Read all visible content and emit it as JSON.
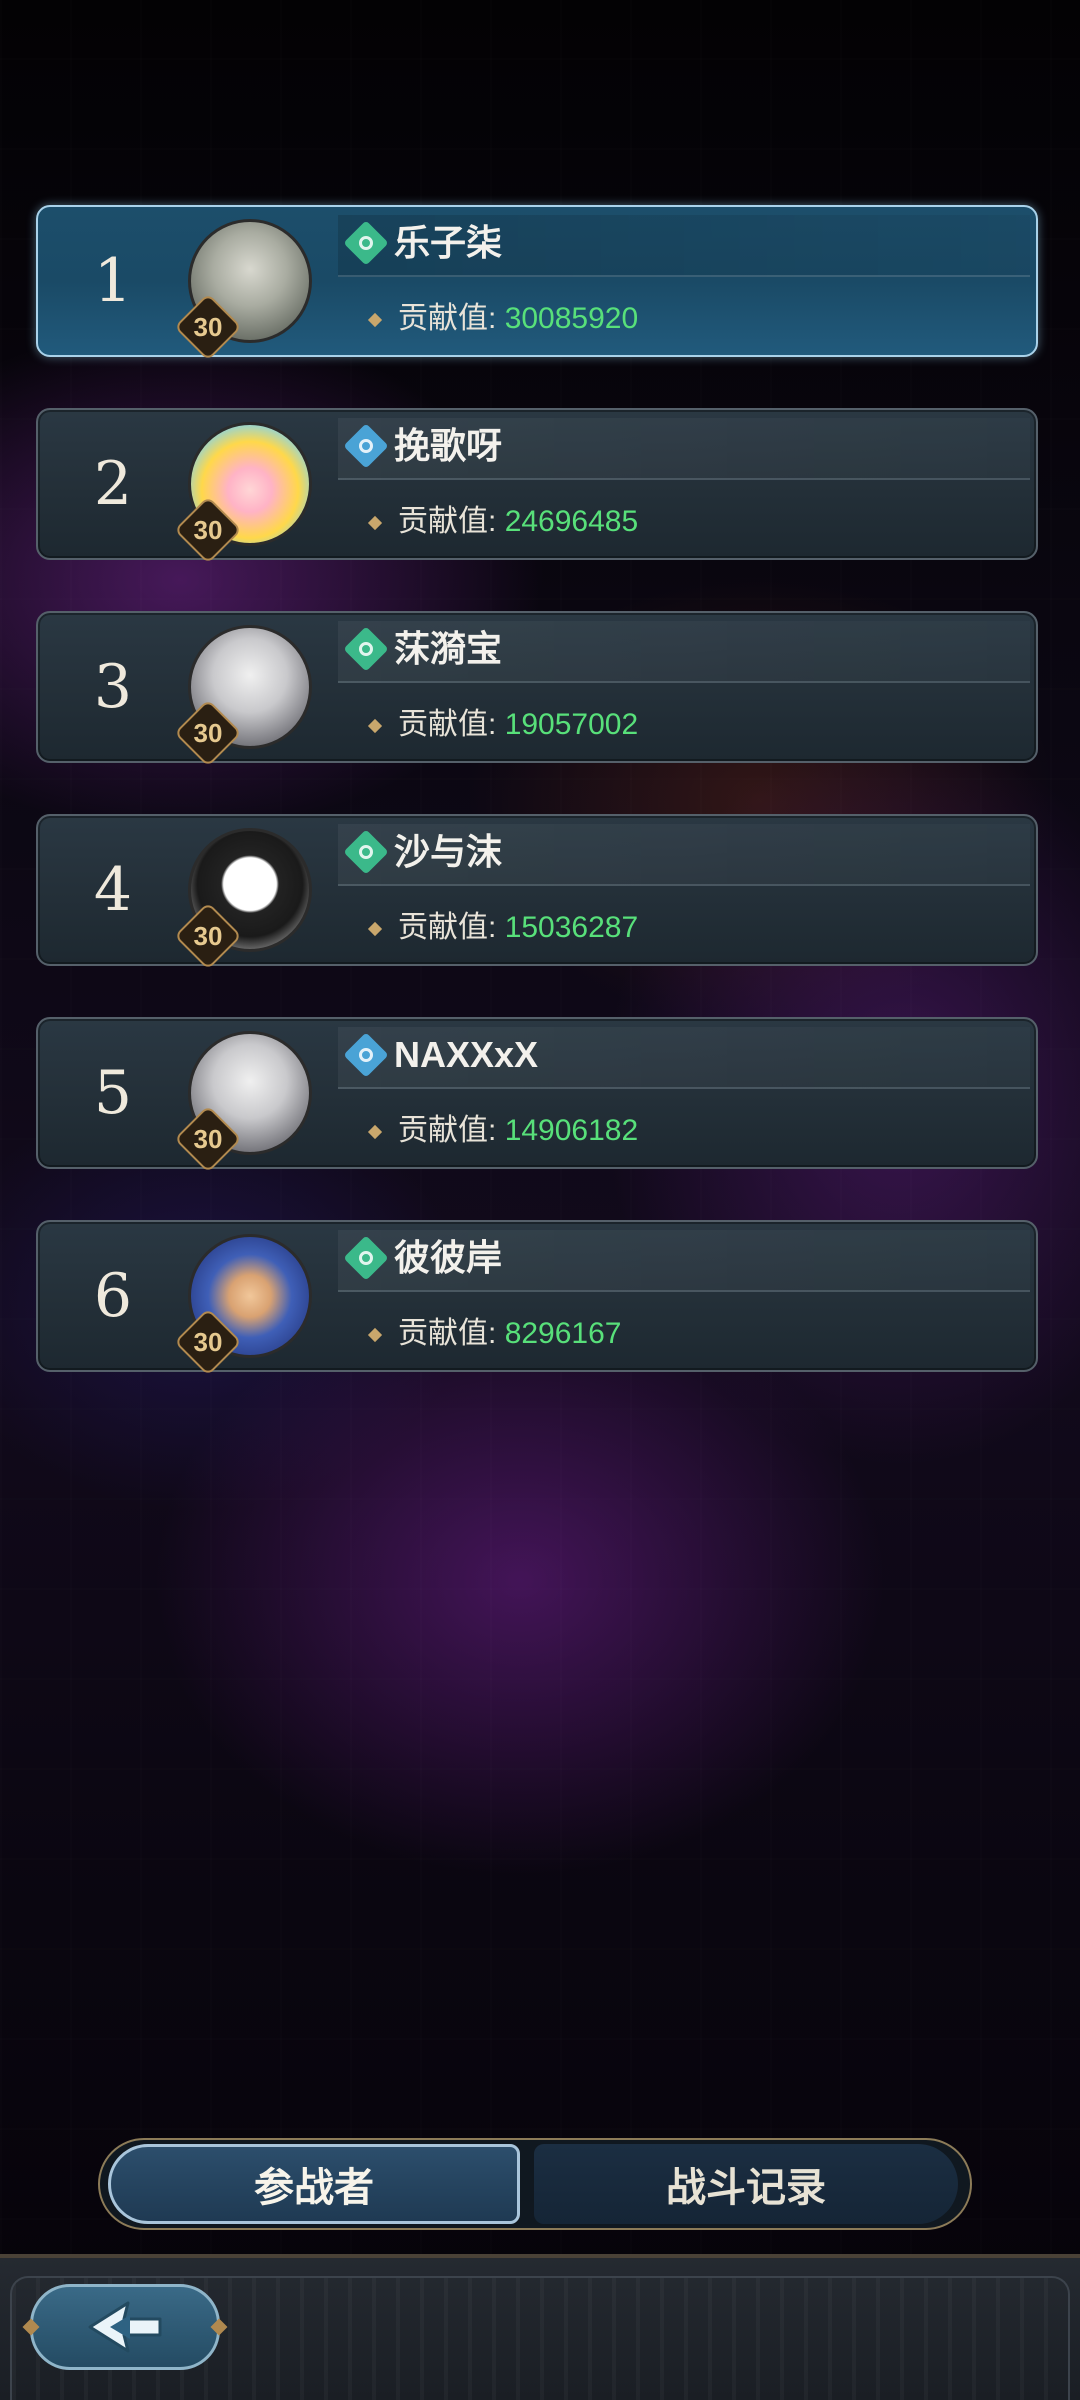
{
  "rankings": [
    {
      "rank": "1",
      "level": "30",
      "name": "乐子柒",
      "contribution_label": "贡献值:",
      "contribution": "30085920",
      "element_color": "#3bb98a",
      "active": true
    },
    {
      "rank": "2",
      "level": "30",
      "name": "挽歌呀",
      "contribution_label": "贡献值:",
      "contribution": "24696485",
      "element_color": "#4aa3d6",
      "active": false
    },
    {
      "rank": "3",
      "level": "30",
      "name": "莯漪宝",
      "contribution_label": "贡献值:",
      "contribution": "19057002",
      "element_color": "#3bb98a",
      "active": false
    },
    {
      "rank": "4",
      "level": "30",
      "name": "沙与沫",
      "contribution_label": "贡献值:",
      "contribution": "15036287",
      "element_color": "#3bb98a",
      "active": false
    },
    {
      "rank": "5",
      "level": "30",
      "name": "NAXXxX",
      "contribution_label": "贡献值:",
      "contribution": "14906182",
      "element_color": "#4aa3d6",
      "active": false
    },
    {
      "rank": "6",
      "level": "30",
      "name": "彼彼岸",
      "contribution_label": "贡献值:",
      "contribution": "8296167",
      "element_color": "#3bb98a",
      "active": false
    }
  ],
  "tabs": {
    "participants": "参战者",
    "battle_log": "战斗记录"
  },
  "back_button": {
    "icon": "back-arrow-icon"
  },
  "colors": {
    "contribution_value": "#58e07a",
    "active_row": "#1a4a66"
  }
}
